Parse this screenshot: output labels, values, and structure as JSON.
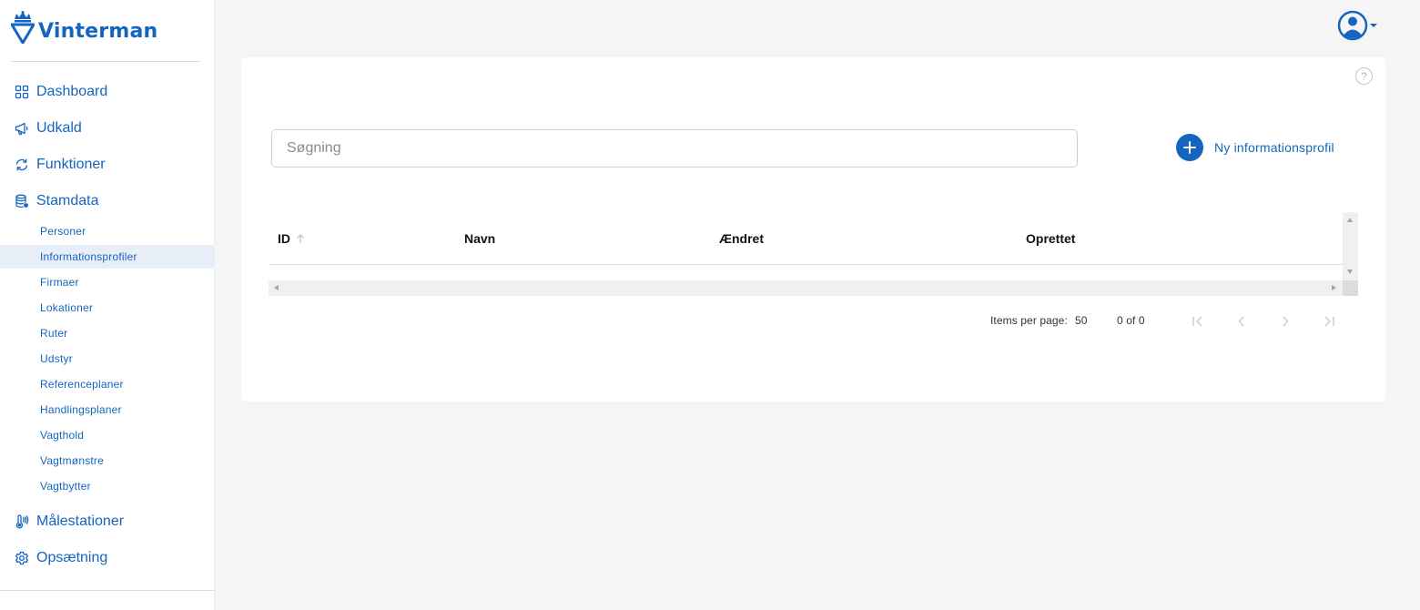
{
  "app": {
    "brand": "Vinterman",
    "brand_color": "#1565c0"
  },
  "sidebar": {
    "main_items": [
      {
        "label": "Dashboard",
        "icon": "grid-icon"
      },
      {
        "label": "Udkald",
        "icon": "megaphone-icon"
      },
      {
        "label": "Funktioner",
        "icon": "refresh-icon"
      },
      {
        "label": "Stamdata",
        "icon": "database-icon"
      }
    ],
    "sub_items": [
      {
        "label": "Personer"
      },
      {
        "label": "Informationsprofiler",
        "active": true
      },
      {
        "label": "Firmaer"
      },
      {
        "label": "Lokationer"
      },
      {
        "label": "Ruter"
      },
      {
        "label": "Udstyr"
      },
      {
        "label": "Referenceplaner"
      },
      {
        "label": "Handlingsplaner"
      },
      {
        "label": "Vagthold"
      },
      {
        "label": "Vagtmønstre"
      },
      {
        "label": "Vagtbytter"
      }
    ],
    "bottom_items": [
      {
        "label": "Målestationer",
        "icon": "thermometer-icon"
      },
      {
        "label": "Opsætning",
        "icon": "gear-icon"
      }
    ]
  },
  "toolbar": {
    "help_label": "?",
    "search_placeholder": "Søgning",
    "new_button_label": "Ny informationsprofil"
  },
  "table": {
    "columns": [
      {
        "label": "ID",
        "sortable": true
      },
      {
        "label": "Navn"
      },
      {
        "label": "Ændret"
      },
      {
        "label": "Oprettet"
      }
    ],
    "rows": []
  },
  "paginator": {
    "items_per_page_label": "Items per page:",
    "items_per_page_value": "50",
    "range_label": "0 of 0"
  }
}
